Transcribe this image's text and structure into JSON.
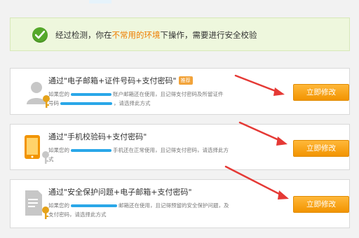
{
  "alert": {
    "icon": "check-circle-icon",
    "text_before": "经过检测，你在",
    "text_highlight": "不常用的环境",
    "text_after": "下操作，需要进行安全校验"
  },
  "options": [
    {
      "icon": "user-key-icon",
      "title": "通过\"电子邮箱+证件号码+支付密码\"",
      "badge": "推荐",
      "desc_prefix": "如果您的",
      "desc_line1": "账户邮箱还在使用，且记得支付密码及所留证件",
      "desc_line2a": "号码",
      "desc_line2b": "，请选择此方式",
      "button": "立即修改"
    },
    {
      "icon": "phone-key-icon",
      "title": "通过\"手机校验码+支付密码\"",
      "desc_prefix": "如果您的",
      "desc_line1": "手机还在正常使用，且记得支付密码，请选择此方",
      "desc_line2": "式",
      "button": "立即修改"
    },
    {
      "icon": "document-key-icon",
      "title": "通过\"安全保护问题+电子邮箱+支付密码\"",
      "desc_prefix": "如果您的",
      "desc_line1": "邮箱还在使用，且记得预留的安全保护问题，及",
      "desc_line2": "支付密码，请选择此方式",
      "button": "立即修改"
    }
  ],
  "colors": {
    "button": "#f29400",
    "highlight": "#ef7d00",
    "alert_bg": "#eef7dd",
    "arrow": "#e53935",
    "redaction": "#2aa7e8"
  }
}
